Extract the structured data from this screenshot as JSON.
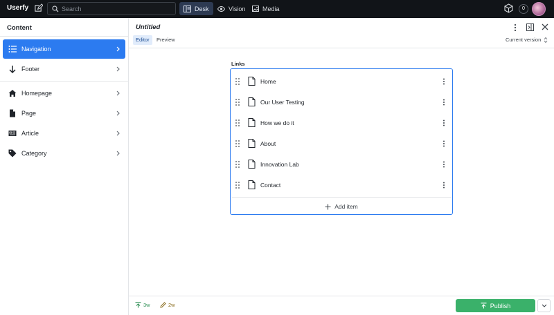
{
  "topbar": {
    "brand": "Userfy",
    "search_placeholder": "Search",
    "tools": [
      {
        "label": "Desk",
        "icon": "desk-icon",
        "active": true
      },
      {
        "label": "Vision",
        "icon": "eye-icon",
        "active": false
      },
      {
        "label": "Media",
        "icon": "image-icon",
        "active": false
      }
    ],
    "notification_count": "0"
  },
  "sidebar": {
    "title": "Content",
    "items": [
      {
        "label": "Navigation",
        "icon": "list-icon",
        "active": true
      },
      {
        "label": "Footer",
        "icon": "arrow-down-icon",
        "active": false
      },
      {
        "label": "Homepage",
        "icon": "home-icon",
        "active": false
      },
      {
        "label": "Page",
        "icon": "document-icon",
        "active": false
      },
      {
        "label": "Article",
        "icon": "newspaper-icon",
        "active": false
      },
      {
        "label": "Category",
        "icon": "tag-icon",
        "active": false
      }
    ]
  },
  "document": {
    "title": "Untitled",
    "tabs": [
      {
        "label": "Editor",
        "active": true
      },
      {
        "label": "Preview",
        "active": false
      }
    ],
    "version": "Current version"
  },
  "links": {
    "label": "Links",
    "items": [
      "Home",
      "Our User Testing",
      "How we do it",
      "About",
      "Innovation Lab",
      "Contact"
    ],
    "add_label": "Add item"
  },
  "footer": {
    "published_ago": "3w",
    "edited_ago": "2w",
    "publish_label": "Publish"
  },
  "colors": {
    "accent": "#2c7bf0",
    "publish": "#3ab16a",
    "topbar": "#111418"
  }
}
